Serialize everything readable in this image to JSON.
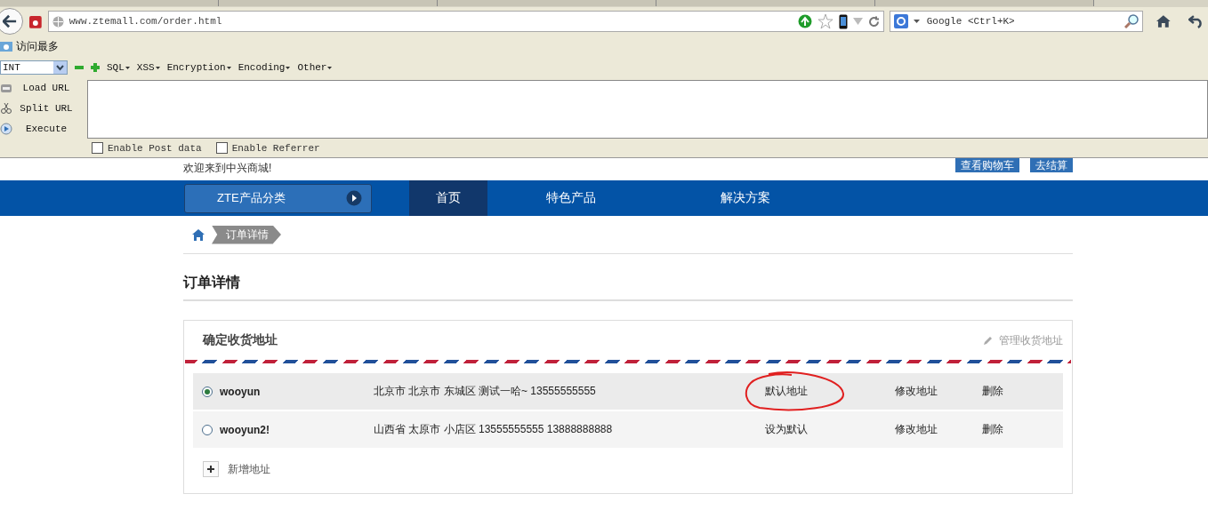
{
  "browser": {
    "url": "www.ztemall.com/order.html",
    "search_placeholder": "Google <Ctrl+K>",
    "bookmark": "访问最多"
  },
  "hackbar": {
    "select_value": "INT",
    "menus": [
      "SQL",
      "XSS",
      "Encryption",
      "Encoding",
      "Other"
    ],
    "buttons": [
      "Load URL",
      "Split URL",
      "Execute"
    ],
    "options": [
      {
        "label": "Enable Post data",
        "checked": false
      },
      {
        "label": "Enable Referrer",
        "checked": false
      }
    ]
  },
  "header": {
    "welcome": "欢迎来到中兴商城!",
    "buttons": [
      "查看购物车",
      "去结算"
    ]
  },
  "nav": {
    "category": "ZTE产品分类",
    "items": [
      {
        "label": "首页",
        "selected": true
      },
      {
        "label": "特色产品",
        "selected": false
      },
      {
        "label": "解决方案",
        "selected": false
      }
    ]
  },
  "breadcrumb": [
    "订单详情"
  ],
  "page_title": "订单详情",
  "address_card": {
    "title": "确定收货地址",
    "manage_link": "管理收货地址",
    "add_label": "新增地址",
    "addresses": [
      {
        "selected": true,
        "name": "wooyun",
        "address": "北京市 北京市 东城区 测试一哈~ 13555555555",
        "default_action": "默认地址",
        "edit": "修改地址",
        "delete": "删除"
      },
      {
        "selected": false,
        "name": "wooyun2!",
        "address": "山西省 太原市 小店区 13555555555 13888888888",
        "default_action": "设为默认",
        "edit": "修改地址",
        "delete": "删除"
      }
    ]
  }
}
